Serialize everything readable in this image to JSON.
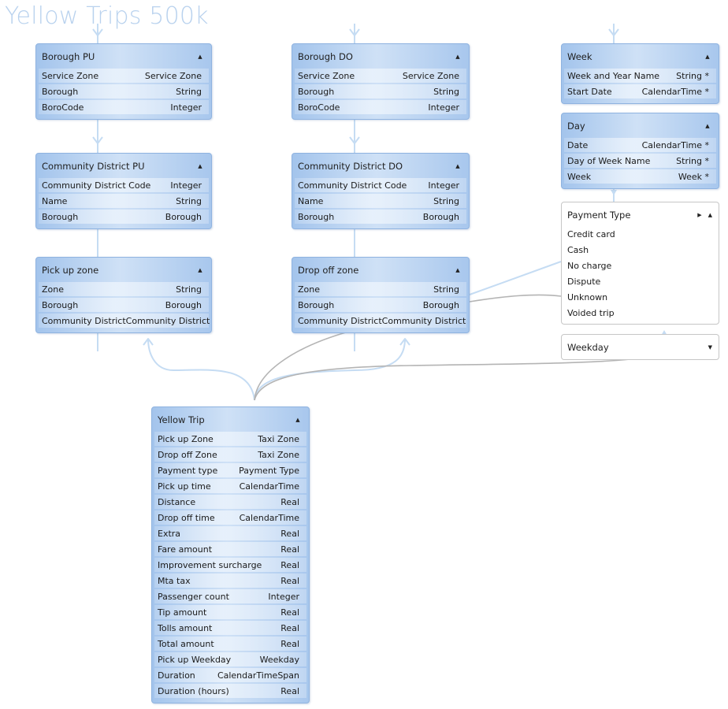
{
  "title": "Yellow Trips 500k",
  "entities": {
    "borough_pu": {
      "name": "Borough PU",
      "attributes": [
        {
          "name": "Service Zone",
          "type": "Service  Zone"
        },
        {
          "name": "Borough",
          "type": "String"
        },
        {
          "name": "BoroCode",
          "type": "Integer"
        }
      ]
    },
    "borough_do": {
      "name": "Borough DO",
      "attributes": [
        {
          "name": "Service Zone",
          "type": "Service  Zone"
        },
        {
          "name": "Borough",
          "type": "String"
        },
        {
          "name": "BoroCode",
          "type": "Integer"
        }
      ]
    },
    "week": {
      "name": "Week",
      "attributes": [
        {
          "name": "Week and Year Name",
          "type": "String *"
        },
        {
          "name": "Start Date",
          "type": "CalendarTime *"
        }
      ]
    },
    "day": {
      "name": "Day",
      "attributes": [
        {
          "name": "Date",
          "type": "CalendarTime *"
        },
        {
          "name": "Day of Week Name",
          "type": "String *"
        },
        {
          "name": "Week",
          "type": "Week *"
        }
      ]
    },
    "community_district_pu": {
      "name": "Community District PU",
      "attributes": [
        {
          "name": "Community District Code",
          "type": "Integer"
        },
        {
          "name": "Name",
          "type": "String"
        },
        {
          "name": "Borough",
          "type": "Borough"
        }
      ]
    },
    "community_district_do": {
      "name": "Community District DO",
      "attributes": [
        {
          "name": "Community District Code",
          "type": "Integer"
        },
        {
          "name": "Name",
          "type": "String"
        },
        {
          "name": "Borough",
          "type": "Borough"
        }
      ]
    },
    "pick_up_zone": {
      "name": "Pick up zone",
      "attributes": [
        {
          "name": "Zone",
          "type": "String"
        },
        {
          "name": "Borough",
          "type": "Borough"
        },
        {
          "name": "Community District",
          "type": "Community District"
        }
      ]
    },
    "drop_off_zone": {
      "name": "Drop off zone",
      "attributes": [
        {
          "name": "Zone",
          "type": "String"
        },
        {
          "name": "Borough",
          "type": "Borough"
        },
        {
          "name": "Community District",
          "type": "Community District"
        }
      ]
    },
    "yellow_trip": {
      "name": "Yellow Trip",
      "attributes": [
        {
          "name": "Pick up Zone",
          "type": "Taxi Zone"
        },
        {
          "name": "Drop off  Zone",
          "type": "Taxi Zone"
        },
        {
          "name": "Payment type",
          "type": "Payment Type"
        },
        {
          "name": "Pick up time",
          "type": "CalendarTime"
        },
        {
          "name": "Distance",
          "type": "Real"
        },
        {
          "name": "Drop off time",
          "type": "CalendarTime"
        },
        {
          "name": "Extra",
          "type": "Real"
        },
        {
          "name": "Fare amount",
          "type": "Real"
        },
        {
          "name": "Improvement surcharge",
          "type": "Real"
        },
        {
          "name": "Mta tax",
          "type": "Real"
        },
        {
          "name": "Passenger count",
          "type": "Integer"
        },
        {
          "name": "Tip amount",
          "type": "Real"
        },
        {
          "name": "Tolls amount",
          "type": "Real"
        },
        {
          "name": "Total amount",
          "type": "Real"
        },
        {
          "name": "Pick up Weekday",
          "type": "Weekday"
        },
        {
          "name": "Duration",
          "type": "CalendarTimeSpan"
        },
        {
          "name": "Duration (hours)",
          "type": "Real"
        }
      ]
    }
  },
  "enums": {
    "payment_type": {
      "name": "Payment Type",
      "members": [
        "Credit card",
        "Cash",
        "No charge",
        "Dispute",
        "Unknown",
        "Voided trip"
      ]
    },
    "weekday": {
      "name": "Weekday",
      "members": []
    }
  },
  "icons": {
    "collapse": "collapse-arrow-icon",
    "expand": "expand-arrow-icon",
    "navigate": "navigate-right-icon"
  },
  "colors": {
    "entity_fill_edge": "#a3c4ec",
    "entity_fill_center": "#cfe1f6",
    "entity_border": "#8fb3e0",
    "link_light": "#c5dcf3",
    "link_grey": "#b4b4b4",
    "title": "#b9d2ee"
  }
}
